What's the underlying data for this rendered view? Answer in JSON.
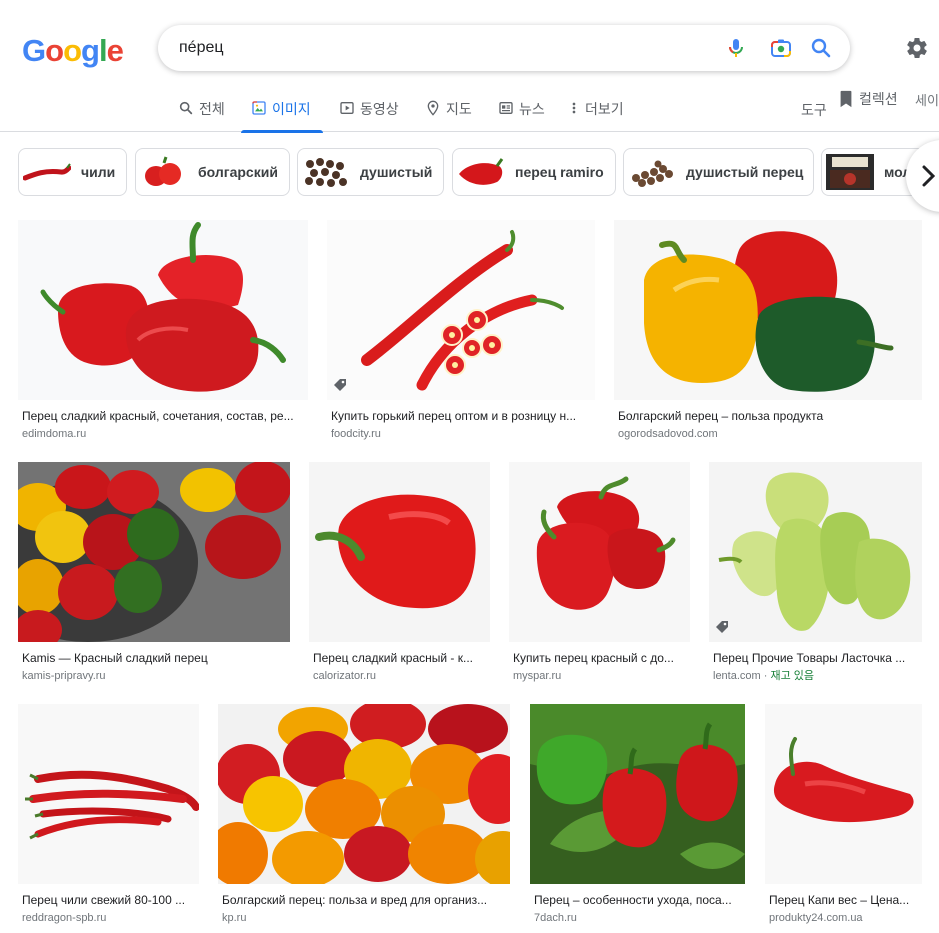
{
  "header": {
    "logo_letters": [
      {
        "ch": "G",
        "color": "#4285F4"
      },
      {
        "ch": "o",
        "color": "#EA4335"
      },
      {
        "ch": "o",
        "color": "#FBBC05"
      },
      {
        "ch": "g",
        "color": "#4285F4"
      },
      {
        "ch": "l",
        "color": "#34A853"
      },
      {
        "ch": "e",
        "color": "#EA4335"
      }
    ],
    "query": "пéрец"
  },
  "tabs": [
    {
      "label": "전체",
      "icon": "search-icon"
    },
    {
      "label": "이미지",
      "icon": "image-icon",
      "active": true
    },
    {
      "label": "동영상",
      "icon": "video-icon"
    },
    {
      "label": "지도",
      "icon": "map-pin-icon"
    },
    {
      "label": "뉴스",
      "icon": "news-icon"
    },
    {
      "label": "더보기",
      "icon": "more-vertical-icon"
    }
  ],
  "tools_label": "도구",
  "collections_label": "컬렉션",
  "safesearch_label": "세이",
  "chips": [
    {
      "label": "чили"
    },
    {
      "label": "болгарский"
    },
    {
      "label": "душистый"
    },
    {
      "label": "перец ramiro"
    },
    {
      "label": "душистый перец"
    },
    {
      "label": "мол"
    }
  ],
  "results": [
    {
      "title": "Перец сладкий красный, сочетания, состав, ре...",
      "source": "edimdoma.ru"
    },
    {
      "title": "Купить горький перец оптом и в розницу н...",
      "source": "foodcity.ru"
    },
    {
      "title": "Болгарский перец – польза продукта",
      "source": "ogorodsadovod.com"
    },
    {
      "title": "Kamis — Красный сладкий перец",
      "source": "kamis-pripravy.ru"
    },
    {
      "title": "Перец сладкий красный - к...",
      "source": "calorizator.ru"
    },
    {
      "title": "Купить перец красный с до...",
      "source": "myspar.ru"
    },
    {
      "title": "Перец Прочие Товары Ласточка ...",
      "source": "lenta.com",
      "stock": "재고 있음"
    },
    {
      "title": "Перец чили свежий 80-100 ...",
      "source": "reddragon-spb.ru"
    },
    {
      "title": "Болгарский перец: польза и вред для организ...",
      "source": "kp.ru"
    },
    {
      "title": "Перец – особенности ухода, поса...",
      "source": "7dach.ru"
    },
    {
      "title": "Перец Капи вес – Цена...",
      "source": "produkty24.com.ua"
    }
  ]
}
